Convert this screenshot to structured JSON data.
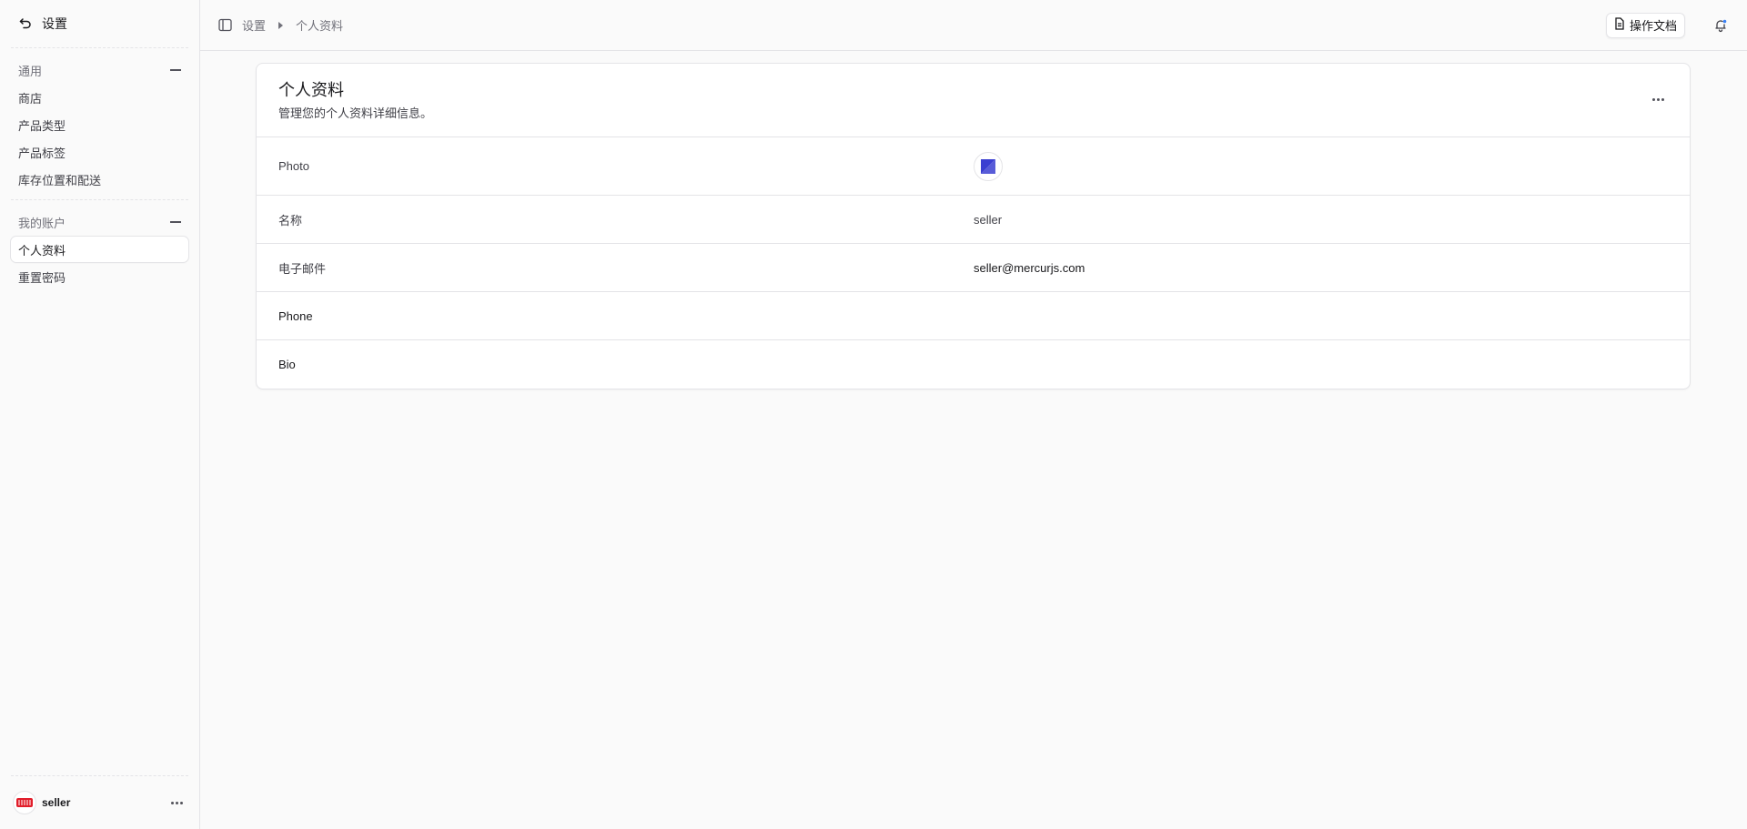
{
  "sidebar": {
    "back_label": "设置",
    "sections": [
      {
        "title": "通用",
        "items": [
          "商店",
          "产品类型",
          "产品标签",
          "库存位置和配送"
        ]
      },
      {
        "title": "我的账户",
        "items": [
          "个人资料",
          "重置密码"
        ]
      }
    ],
    "active_item": "个人资料",
    "user": {
      "name": "seller"
    }
  },
  "topbar": {
    "breadcrumb": [
      "设置",
      "个人资料"
    ],
    "docs_label": "操作文档"
  },
  "profile": {
    "title": "个人资料",
    "subtitle": "管理您的个人资料详细信息。",
    "fields": [
      {
        "label": "Photo",
        "value": ""
      },
      {
        "label": "名称",
        "value": "seller"
      },
      {
        "label": "电子邮件",
        "value": "seller@mercurjs.com"
      },
      {
        "label": "Phone",
        "value": ""
      },
      {
        "label": "Bio",
        "value": ""
      }
    ]
  },
  "colors": {
    "brand_logo": "#3b3fd1",
    "avatar_accent": "#e11d2a"
  }
}
